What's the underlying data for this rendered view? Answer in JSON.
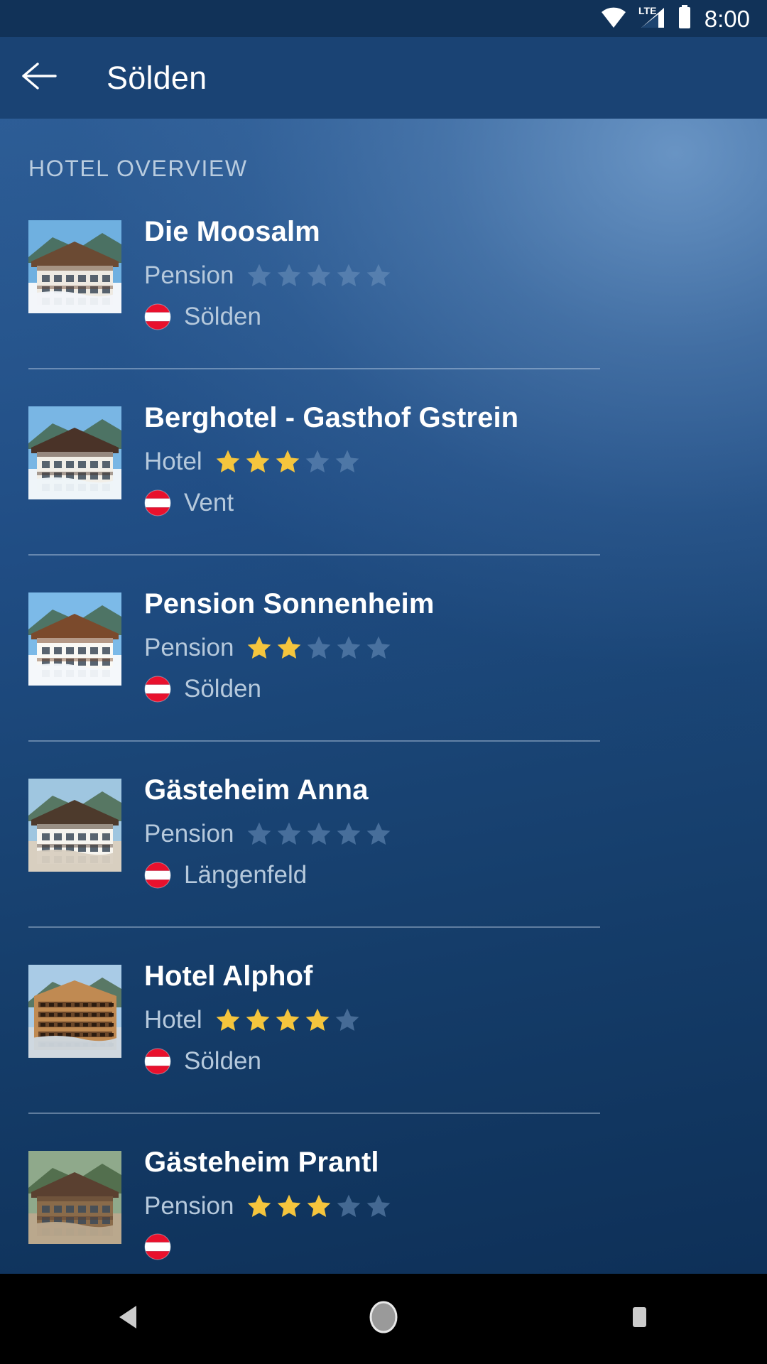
{
  "status_bar": {
    "time": "8:00",
    "icons": [
      "wifi-icon",
      "lte-label",
      "signal-icon",
      "battery-icon"
    ],
    "network_label": "LTE",
    "background_color": "#113258"
  },
  "app_bar": {
    "title": "Sölden",
    "back_icon": "arrow-left-icon",
    "background_color": "#1a4374"
  },
  "section": {
    "title": "HOTEL OVERVIEW"
  },
  "colors": {
    "star_filled": "#f5c53d",
    "star_empty": "#6f93bd",
    "flag_red": "#e8112d",
    "flag_white": "#ffffff",
    "text_primary": "#ffffff",
    "text_secondary": "#b6c9dc",
    "divider": "#c8daec"
  },
  "hotels": [
    {
      "name": "Die Moosalm",
      "type": "Pension",
      "rating": 0,
      "max_rating": 5,
      "country": "Austria",
      "location": "Sölden",
      "thumbnail": "alpine-chalet-snow-photo"
    },
    {
      "name": "Berghotel - Gasthof Gstrein",
      "type": "Hotel",
      "rating": 3,
      "max_rating": 5,
      "country": "Austria",
      "location": "Vent",
      "thumbnail": "curved-dark-roof-hotel-photo"
    },
    {
      "name": "Pension Sonnenheim",
      "type": "Pension",
      "rating": 2,
      "max_rating": 5,
      "country": "Austria",
      "location": "Sölden",
      "thumbnail": "white-gabled-pension-photo"
    },
    {
      "name": "Gästeheim Anna",
      "type": "Pension",
      "rating": 0,
      "max_rating": 5,
      "country": "Austria",
      "location": "Längenfeld",
      "thumbnail": "white-guesthouse-anna-sign-photo"
    },
    {
      "name": "Hotel Alphof",
      "type": "Hotel",
      "rating": 4,
      "max_rating": 5,
      "country": "Austria",
      "location": "Sölden",
      "thumbnail": "large-wooden-balcony-hotel-photo"
    },
    {
      "name": "Gästeheim Prantl",
      "type": "Pension",
      "rating": 3,
      "max_rating": 5,
      "country": "Austria",
      "location": "",
      "thumbnail": "wooden-chalet-forest-photo"
    }
  ],
  "nav_bar": {
    "buttons": [
      {
        "name": "back",
        "icon": "triangle-back-icon"
      },
      {
        "name": "home",
        "icon": "circle-home-icon"
      },
      {
        "name": "recents",
        "icon": "square-recents-icon"
      }
    ],
    "background_color": "#000000"
  }
}
